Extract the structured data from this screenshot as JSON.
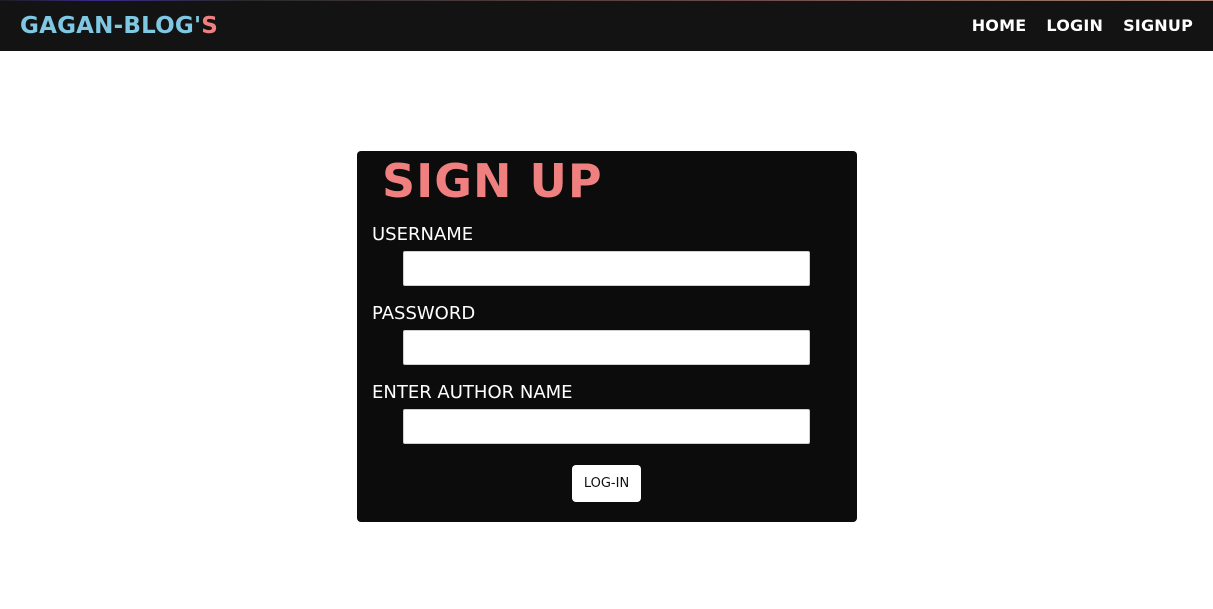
{
  "navbar": {
    "brand_main": "GAGAN-BLOG'",
    "brand_tail": "S",
    "links": [
      {
        "label": "HOME"
      },
      {
        "label": "LOGIN"
      },
      {
        "label": "SIGNUP"
      }
    ]
  },
  "form": {
    "title": "SIGN UP",
    "fields": [
      {
        "label": "USERNAME",
        "value": "",
        "placeholder": ""
      },
      {
        "label": "PASSWORD",
        "value": "",
        "placeholder": ""
      },
      {
        "label": "ENTER AUTHOR NAME",
        "value": "",
        "placeholder": ""
      }
    ],
    "submit_label": "LOG-IN"
  },
  "colors": {
    "navbar_bg": "#131313",
    "brand_blue": "#7ec8e3",
    "accent_pink": "#f08080",
    "card_bg": "#0c0c0c"
  }
}
